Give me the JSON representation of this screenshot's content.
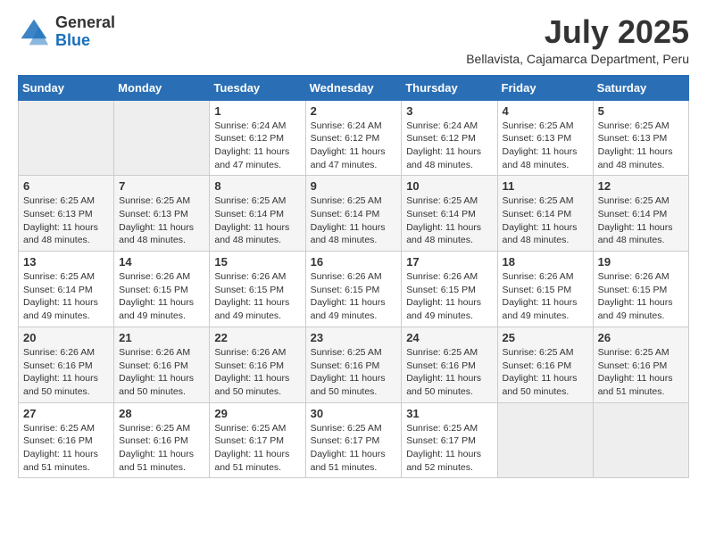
{
  "header": {
    "logo_general": "General",
    "logo_blue": "Blue",
    "month_title": "July 2025",
    "location": "Bellavista, Cajamarca Department, Peru"
  },
  "days_of_week": [
    "Sunday",
    "Monday",
    "Tuesday",
    "Wednesday",
    "Thursday",
    "Friday",
    "Saturday"
  ],
  "weeks": [
    [
      {
        "day": "",
        "info": ""
      },
      {
        "day": "",
        "info": ""
      },
      {
        "day": "1",
        "info": "Sunrise: 6:24 AM\nSunset: 6:12 PM\nDaylight: 11 hours and 47 minutes."
      },
      {
        "day": "2",
        "info": "Sunrise: 6:24 AM\nSunset: 6:12 PM\nDaylight: 11 hours and 47 minutes."
      },
      {
        "day": "3",
        "info": "Sunrise: 6:24 AM\nSunset: 6:12 PM\nDaylight: 11 hours and 48 minutes."
      },
      {
        "day": "4",
        "info": "Sunrise: 6:25 AM\nSunset: 6:13 PM\nDaylight: 11 hours and 48 minutes."
      },
      {
        "day": "5",
        "info": "Sunrise: 6:25 AM\nSunset: 6:13 PM\nDaylight: 11 hours and 48 minutes."
      }
    ],
    [
      {
        "day": "6",
        "info": "Sunrise: 6:25 AM\nSunset: 6:13 PM\nDaylight: 11 hours and 48 minutes."
      },
      {
        "day": "7",
        "info": "Sunrise: 6:25 AM\nSunset: 6:13 PM\nDaylight: 11 hours and 48 minutes."
      },
      {
        "day": "8",
        "info": "Sunrise: 6:25 AM\nSunset: 6:14 PM\nDaylight: 11 hours and 48 minutes."
      },
      {
        "day": "9",
        "info": "Sunrise: 6:25 AM\nSunset: 6:14 PM\nDaylight: 11 hours and 48 minutes."
      },
      {
        "day": "10",
        "info": "Sunrise: 6:25 AM\nSunset: 6:14 PM\nDaylight: 11 hours and 48 minutes."
      },
      {
        "day": "11",
        "info": "Sunrise: 6:25 AM\nSunset: 6:14 PM\nDaylight: 11 hours and 48 minutes."
      },
      {
        "day": "12",
        "info": "Sunrise: 6:25 AM\nSunset: 6:14 PM\nDaylight: 11 hours and 48 minutes."
      }
    ],
    [
      {
        "day": "13",
        "info": "Sunrise: 6:25 AM\nSunset: 6:14 PM\nDaylight: 11 hours and 49 minutes."
      },
      {
        "day": "14",
        "info": "Sunrise: 6:26 AM\nSunset: 6:15 PM\nDaylight: 11 hours and 49 minutes."
      },
      {
        "day": "15",
        "info": "Sunrise: 6:26 AM\nSunset: 6:15 PM\nDaylight: 11 hours and 49 minutes."
      },
      {
        "day": "16",
        "info": "Sunrise: 6:26 AM\nSunset: 6:15 PM\nDaylight: 11 hours and 49 minutes."
      },
      {
        "day": "17",
        "info": "Sunrise: 6:26 AM\nSunset: 6:15 PM\nDaylight: 11 hours and 49 minutes."
      },
      {
        "day": "18",
        "info": "Sunrise: 6:26 AM\nSunset: 6:15 PM\nDaylight: 11 hours and 49 minutes."
      },
      {
        "day": "19",
        "info": "Sunrise: 6:26 AM\nSunset: 6:15 PM\nDaylight: 11 hours and 49 minutes."
      }
    ],
    [
      {
        "day": "20",
        "info": "Sunrise: 6:26 AM\nSunset: 6:16 PM\nDaylight: 11 hours and 50 minutes."
      },
      {
        "day": "21",
        "info": "Sunrise: 6:26 AM\nSunset: 6:16 PM\nDaylight: 11 hours and 50 minutes."
      },
      {
        "day": "22",
        "info": "Sunrise: 6:26 AM\nSunset: 6:16 PM\nDaylight: 11 hours and 50 minutes."
      },
      {
        "day": "23",
        "info": "Sunrise: 6:25 AM\nSunset: 6:16 PM\nDaylight: 11 hours and 50 minutes."
      },
      {
        "day": "24",
        "info": "Sunrise: 6:25 AM\nSunset: 6:16 PM\nDaylight: 11 hours and 50 minutes."
      },
      {
        "day": "25",
        "info": "Sunrise: 6:25 AM\nSunset: 6:16 PM\nDaylight: 11 hours and 50 minutes."
      },
      {
        "day": "26",
        "info": "Sunrise: 6:25 AM\nSunset: 6:16 PM\nDaylight: 11 hours and 51 minutes."
      }
    ],
    [
      {
        "day": "27",
        "info": "Sunrise: 6:25 AM\nSunset: 6:16 PM\nDaylight: 11 hours and 51 minutes."
      },
      {
        "day": "28",
        "info": "Sunrise: 6:25 AM\nSunset: 6:16 PM\nDaylight: 11 hours and 51 minutes."
      },
      {
        "day": "29",
        "info": "Sunrise: 6:25 AM\nSunset: 6:17 PM\nDaylight: 11 hours and 51 minutes."
      },
      {
        "day": "30",
        "info": "Sunrise: 6:25 AM\nSunset: 6:17 PM\nDaylight: 11 hours and 51 minutes."
      },
      {
        "day": "31",
        "info": "Sunrise: 6:25 AM\nSunset: 6:17 PM\nDaylight: 11 hours and 52 minutes."
      },
      {
        "day": "",
        "info": ""
      },
      {
        "day": "",
        "info": ""
      }
    ]
  ]
}
